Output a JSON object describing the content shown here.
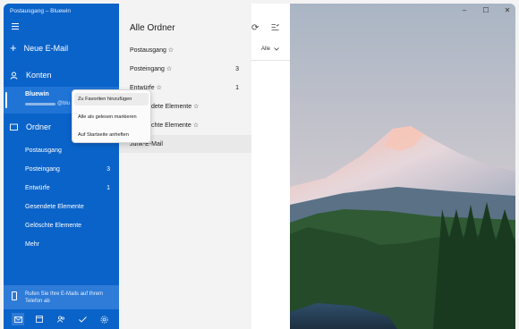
{
  "window": {
    "title": "Postausgang – Bluewin"
  },
  "sidebar": {
    "new_mail": "Neue E-Mail",
    "accounts_label": "Konten",
    "account_name": "Bluewin",
    "account_email": "@blu",
    "folders_label": "Ordner",
    "folders": [
      {
        "label": "Postausgang",
        "count": ""
      },
      {
        "label": "Posteingang",
        "count": "3"
      },
      {
        "label": "Entwürfe",
        "count": "1"
      },
      {
        "label": "Gesendete Elemente",
        "count": ""
      },
      {
        "label": "Gelöschte Elemente",
        "count": ""
      },
      {
        "label": "Mehr",
        "count": ""
      }
    ],
    "phone_promo": "Rufen Sie Ihre E-Mails auf Ihrem Telefon ab"
  },
  "list": {
    "title": "Alle Ordner",
    "rows": [
      {
        "label": "Postausgang ☆",
        "count": ""
      },
      {
        "label": "Posteingang ☆",
        "count": "3"
      },
      {
        "label": "Entwürfe ☆",
        "count": "1"
      },
      {
        "label": "dete Elemente ☆",
        "count": ""
      },
      {
        "label": "chte Elemente ☆",
        "count": ""
      },
      {
        "label": "Junk-E-Mail",
        "count": ""
      }
    ],
    "filter_label": "Alle"
  },
  "context_menu": {
    "items": [
      "Zu Favoriten hinzufügen",
      "Alle als gelesen markieren",
      "Auf Startseite anheften"
    ]
  },
  "icons": {
    "hamburger": "menu-icon",
    "refresh": "refresh-icon",
    "filter": "filter-icon",
    "mail": "mail-icon",
    "calendar": "calendar-icon",
    "people": "people-icon",
    "todo": "todo-icon",
    "settings": "gear-icon"
  },
  "colors": {
    "accent": "#0a63c9"
  }
}
